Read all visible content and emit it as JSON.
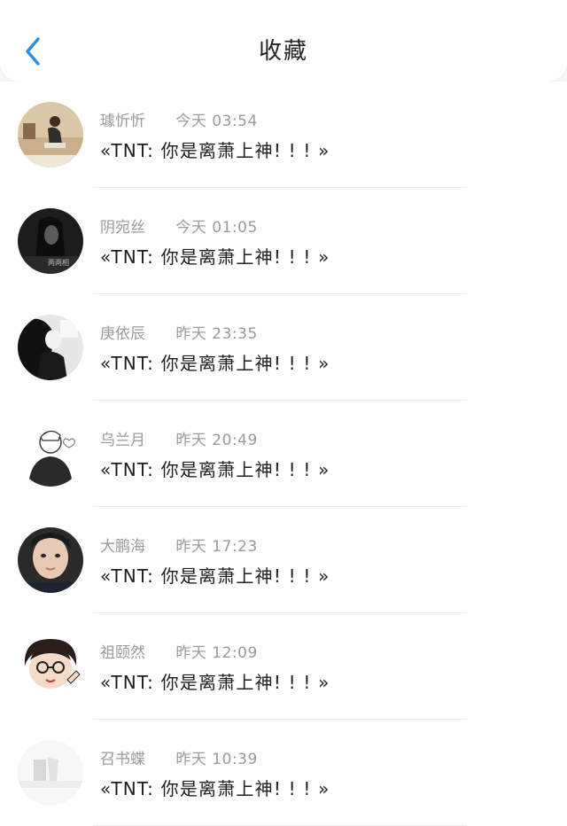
{
  "header": {
    "title": "收藏",
    "back_icon": "chevron-left-icon",
    "accent_color": "#2d8fd9"
  },
  "favorites": [
    {
      "name": "璩忻忻",
      "time": "今天 03:54",
      "message": "«TNT: 你是离萧上神! ! ! »",
      "avatar": "photo-avatar-warm"
    },
    {
      "name": "阴宛丝",
      "time": "今天 01:05",
      "message": "«TNT: 你是离萧上神! ! ! »",
      "avatar": "photo-avatar-dark",
      "avatar_caption": "两两相"
    },
    {
      "name": "庚依辰",
      "time": "昨天 23:35",
      "message": "«TNT: 你是离萧上神! ! ! »",
      "avatar": "photo-avatar-bw"
    },
    {
      "name": "乌兰月",
      "time": "昨天 20:49",
      "message": "«TNT: 你是离萧上神! ! ! »",
      "avatar": "sketch-avatar"
    },
    {
      "name": "大鹏海",
      "time": "昨天 17:23",
      "message": "«TNT: 你是离萧上神! ! ! »",
      "avatar": "photo-avatar-face"
    },
    {
      "name": "祖颐然",
      "time": "昨天 12:09",
      "message": "«TNT: 你是离萧上神! ! ! »",
      "avatar": "cartoon-avatar"
    },
    {
      "name": "召书蝶",
      "time": "昨天 10:39",
      "message": "«TNT: 你是离萧上神! ! ! »",
      "avatar": "faded-avatar"
    }
  ]
}
